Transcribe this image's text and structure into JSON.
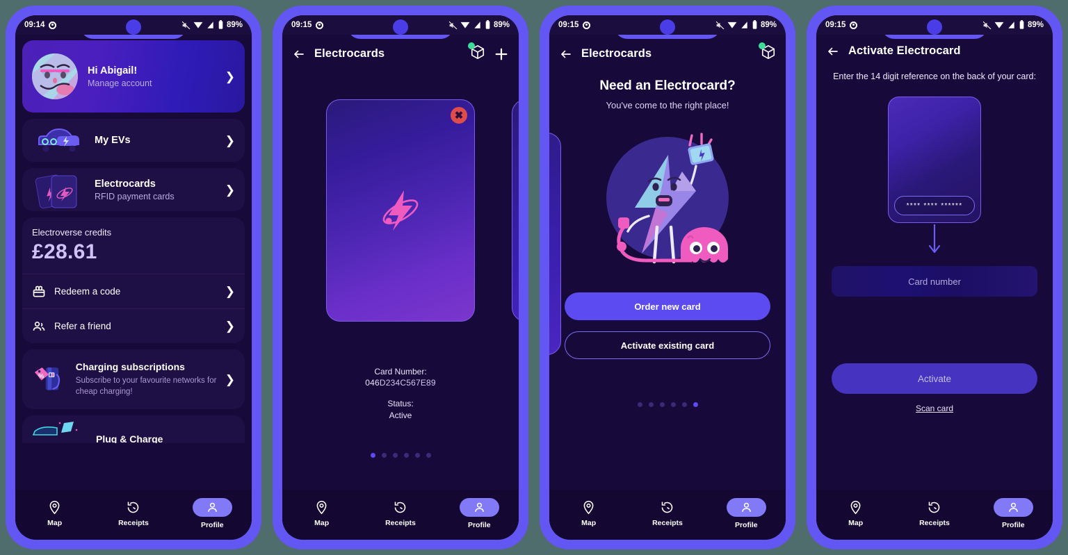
{
  "background_color": "#4e6d6c",
  "phone_frame_color": "#6257f2",
  "screen_bg": "#170a3a",
  "accent_purple": "#5b4bf0",
  "accent_pink": "#f05bc0",
  "status_green": "#3ddc97",
  "screens": [
    {
      "id": "profile",
      "statusbar": {
        "time": "09:14",
        "battery": "89%"
      },
      "profile_card": {
        "greeting": "Hi Abigail!",
        "subtitle": "Manage account",
        "avatar_name": "abigail-avatar"
      },
      "menu": [
        {
          "label": "My EVs",
          "icon": "ev-car-icon"
        },
        {
          "label": "Electrocards",
          "sub": "RFID payment cards",
          "icon": "cards-icon"
        }
      ],
      "credits": {
        "label": "Electroverse credits",
        "value": "£28.61",
        "rows": [
          {
            "label": "Redeem a code",
            "icon": "gift-icon"
          },
          {
            "label": "Refer a friend",
            "icon": "people-icon"
          }
        ]
      },
      "subscription": {
        "title": "Charging subscriptions",
        "desc": "Subscribe to your favourite networks for cheap charging!",
        "icon": "charger-tag-icon"
      },
      "clipped": {
        "title": "Plug & Charge"
      }
    },
    {
      "id": "electrocards-list",
      "statusbar": {
        "time": "09:15",
        "battery": "89%"
      },
      "header": {
        "title": "Electrocards",
        "back_icon": "back-arrow-icon",
        "box_icon": "package-icon",
        "add_icon": "plus-icon",
        "badge": true
      },
      "card": {
        "card_number_label": "Card Number:",
        "card_number_prefix": "046",
        "card_number_rest": "D234C567E89",
        "status_label": "Status:",
        "status_value": "Active",
        "close_icon": "close-icon"
      },
      "pager": {
        "count": 6,
        "active": 0
      }
    },
    {
      "id": "electrocards-empty",
      "statusbar": {
        "time": "09:15",
        "battery": "89%"
      },
      "header": {
        "title": "Electrocards",
        "back_icon": "back-arrow-icon",
        "box_icon": "package-icon",
        "badge": true
      },
      "empty": {
        "title": "Need an Electrocard?",
        "subtitle": "You've come to the right place!",
        "illustration": "bolt-character-octopus-illustration"
      },
      "buttons": {
        "primary": "Order new card",
        "secondary": "Activate existing card"
      },
      "pager": {
        "count": 6,
        "active": 5
      }
    },
    {
      "id": "activate-electrocard",
      "statusbar": {
        "time": "09:15",
        "battery": "89%"
      },
      "header": {
        "title": "Activate Electrocard",
        "back_icon": "back-arrow-icon"
      },
      "description": "Enter the 14 digit reference on the back of your card:",
      "card_back": {
        "masked_reference": "**** **** ******"
      },
      "input": {
        "placeholder": "Card number",
        "value": ""
      },
      "activate_button": "Activate",
      "scan_link": "Scan card"
    }
  ],
  "bottom_nav": {
    "items": [
      {
        "label": "Map",
        "icon": "map-pin-icon",
        "active": false
      },
      {
        "label": "Receipts",
        "icon": "history-icon",
        "active": false
      },
      {
        "label": "Profile",
        "icon": "person-icon",
        "active": true
      }
    ]
  }
}
